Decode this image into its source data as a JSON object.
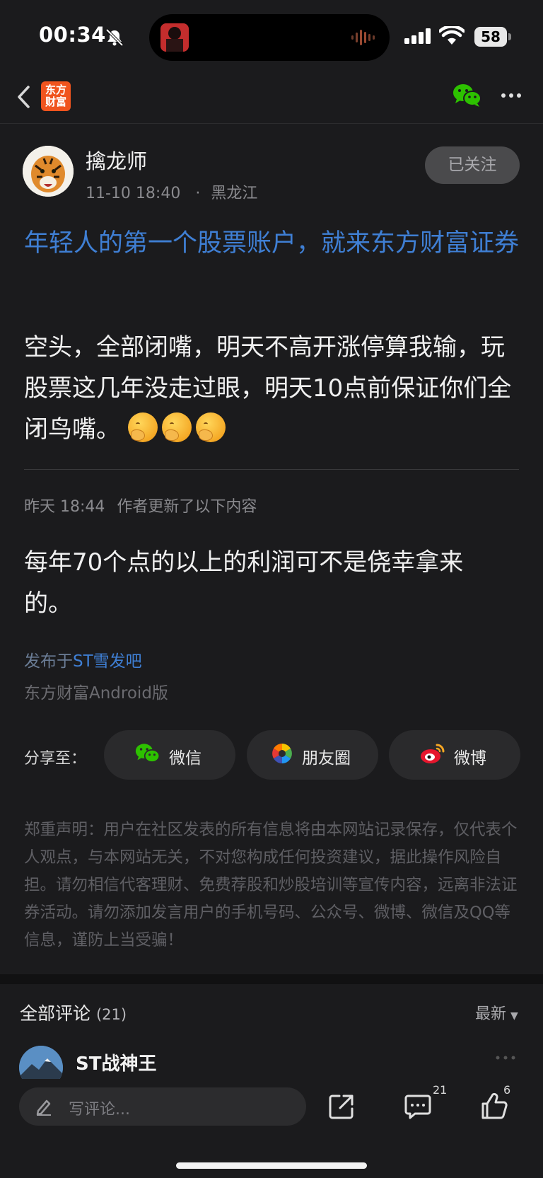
{
  "status_bar": {
    "time": "00:34",
    "battery": "58"
  },
  "nav": {
    "brand_line1": "东方",
    "brand_line2": "财富"
  },
  "author": {
    "name": "擒龙师",
    "date": "11-10 18:40",
    "location": "黑龙江",
    "follow_label": "已关注"
  },
  "post": {
    "title": "年轻人的第一个股票账户，就来东方财富证券",
    "body": "空头，全部闭嘴，明天不高开涨停算我输，玩股票这几年没走过眼，明天10点前保证你们全闭鸟嘴。",
    "update_time": "昨天 18:44",
    "update_label": "作者更新了以下内容",
    "update_body": "每年70个点的以上的利润可不是侥幸拿来的。",
    "published_prefix": "发布于",
    "forum": "ST雪发吧",
    "client": "东方财富Android版"
  },
  "share": {
    "label": "分享至：",
    "wechat": "微信",
    "moments": "朋友圈",
    "weibo": "微博"
  },
  "disclaimer": "郑重声明：用户在社区发表的所有信息将由本网站记录保存，仅代表个人观点，与本网站无关，不对您构成任何投资建议，据此操作风险自担。请勿相信代客理财、免费荐股和炒股培训等宣传内容，远离非法证券活动。请勿添加发言用户的手机号码、公众号、微博、微信及QQ等信息，谨防上当受骗！",
  "comments": {
    "title": "全部评论",
    "count": "(21)",
    "sort": "最新",
    "first_author": "ST战神王"
  },
  "bottom_bar": {
    "placeholder": "写评论...",
    "comment_count": "21",
    "like_count": "6"
  },
  "colors": {
    "background": "#1b1b1d",
    "link_blue": "#3f7fd4",
    "brand_orange": "#f0541e",
    "wechat_green": "#2dc100"
  }
}
